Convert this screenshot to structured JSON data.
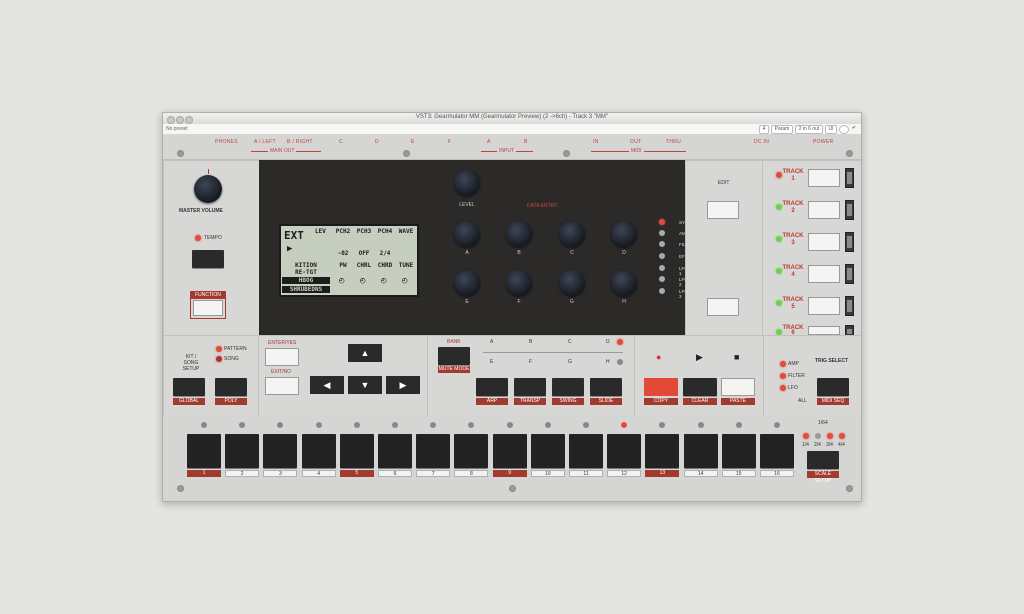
{
  "window": {
    "title": "VST3: Gearmulator MM (Gearmulator Preview) (2 ->6ch) - Track 3 \"MM\"",
    "preset": "No preset"
  },
  "hostbar": {
    "num": "4",
    "param": "Param",
    "io": "2 in 6 out",
    "ui": "UI"
  },
  "io": {
    "phones": "PHONES",
    "a_left": "A / LEFT",
    "b_right": "B / RIGHT",
    "c": "C",
    "d": "D",
    "e": "E",
    "f": "F",
    "in_a": "A",
    "in_b": "B",
    "midi_in": "IN",
    "midi_out": "OUT",
    "midi_thru": "THRU",
    "dc_in": "DC IN",
    "power": "POWER",
    "main_out": "MAIN OUT",
    "input": "INPUT",
    "midi": "MIDI"
  },
  "left": {
    "master_volume": "MASTER VOLUME",
    "tempo": "TEMPO",
    "function": "FUNCTION"
  },
  "lcd": {
    "ext": "EXT",
    "lev": "LEV",
    "p1": "PCH2",
    "p2": "PCH3",
    "p3": "PCH4",
    "p4": "WAVE",
    "v1": "-02",
    "v2": "OFF",
    "v3": "2/4",
    "q1": "PW",
    "q2": "CHRL",
    "q3": "CHRD",
    "q4": "TUNE",
    "name1": "KITION",
    "name2": "RE-TGT",
    "num": "HBOG",
    "sound": "SHRUBEDNS"
  },
  "dataentry": {
    "level": "LEVEL",
    "title": "DATA ENTRY",
    "knobs": [
      "A",
      "B",
      "C",
      "D",
      "E",
      "F",
      "G",
      "H"
    ]
  },
  "menu": {
    "edit": "EDIT",
    "items": [
      "SYNTHESIS",
      "AMPLIFICATION",
      "FILTER",
      "EFFECTS",
      "LFO 1",
      "LFO 2",
      "LFO 3"
    ]
  },
  "tracks": {
    "labels": [
      "TRACK 1",
      "TRACK 2",
      "TRACK 3",
      "TRACK 4",
      "TRACK 5",
      "TRACK 6"
    ],
    "mute": "MUTE"
  },
  "kit": {
    "title": "KIT / SONG SETUP",
    "pattern": "PATTERN",
    "song": "SONG",
    "global": "GLOBAL",
    "poly": "POLY"
  },
  "nav": {
    "enter": "ENTER/YES",
    "exit": "EXIT/NO",
    "up": "▲",
    "down": "▼",
    "left": "◀",
    "right": "▶"
  },
  "bank": {
    "label": "BANK",
    "mute_mode": "MUTE MODE",
    "letters": [
      "A",
      "B",
      "C",
      "D",
      "E",
      "F",
      "G",
      "H"
    ],
    "arp": "ARP",
    "transp": "TRANSP",
    "swing": "SWING",
    "slide": "SLIDE"
  },
  "transport": {
    "record": "●",
    "play": "▶",
    "stop": "■",
    "copy": "COPY",
    "clear": "CLEAR",
    "paste": "PASTE"
  },
  "trig": {
    "title": "TRIG SELECT",
    "amp": "AMP",
    "filter": "FILTER",
    "lfo": "LFO",
    "all": "ALL",
    "midi_seq": "MIDI SEQ"
  },
  "scale": {
    "title": "1/64",
    "opts": [
      "1/4",
      "2/4",
      "3/4",
      "4/4"
    ],
    "setup": "SCALE SETUP"
  },
  "steps": [
    "1",
    "2",
    "3",
    "4",
    "5",
    "6",
    "7",
    "8",
    "9",
    "10",
    "11",
    "12",
    "13",
    "14",
    "15",
    "16"
  ],
  "colors": {
    "accent": "#a23a2e",
    "led_red": "#e34b3a",
    "led_green": "#6fce54"
  }
}
